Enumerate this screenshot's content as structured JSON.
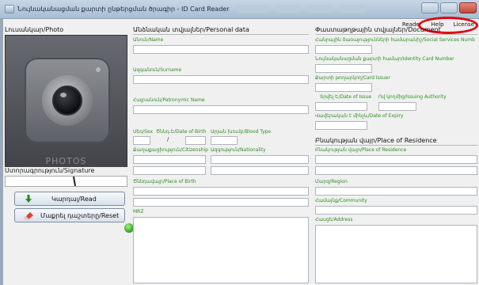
{
  "window": {
    "title": "Նույնականացման քարտի ընթերցման ծրագիր - ID Card Reader"
  },
  "menu": {
    "items": [
      "Reader",
      "Help",
      "License"
    ]
  },
  "left": {
    "photo_title": "Լուսանկար/Photo",
    "photo_placeholder": "PHOTOS",
    "signature_title": "Ստորագրություն/Signature",
    "read_button": "Կարդալ/Read",
    "reset_button": "Մաքրել դաշտերը/Reset"
  },
  "personal": {
    "title": "Անձնական տվյալներ/Personal data",
    "name": "Անուն/Name",
    "surname": "Ազգանուն/Surname",
    "patronymic": "Հայրանուն/Patronymic Name",
    "sex": "Սեռ/Sex",
    "dob": "Ծննդ.Ե/Date of Birth",
    "blood": "Արյան խումբ/Blood Type",
    "dob_sep": "/",
    "citizenship": "Քաղաքացիություն/Citizenship",
    "nationality": "Ազգություն/Nationality",
    "pob": "Ծննդավայր/Place of Birth",
    "mrz": "MRZ"
  },
  "document": {
    "title": "Փաստաթղթային տվյալներ/Document",
    "social": "Հանրային ծառայությունների համարանիշ/Social Services Numb",
    "id_number": "Նույնականացման քարտի համար/Identity Card Number",
    "issuer": "Քարտի թողարկող/Card Issuer",
    "issue_date": "Տրվել Ե/Date of Issue",
    "authority": "Ով կողմից/Issuing Authority",
    "expiry": "Վավերական է մինչև/Date of Expiry"
  },
  "residence": {
    "title": "Բնակության վայր/Place of Residence",
    "place": "Բնակության վայր/Place of Residence",
    "region": "Մարզ/Region",
    "community": "Համայնք/Community",
    "address": "Հասցե/Address"
  }
}
